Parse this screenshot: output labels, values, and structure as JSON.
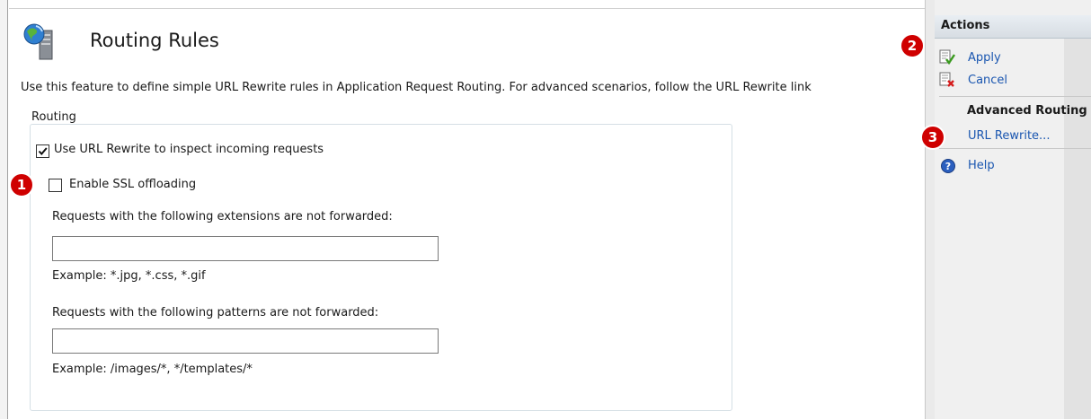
{
  "header": {
    "title": "Routing Rules",
    "description": "Use this feature to define simple URL Rewrite rules in Application Request Routing.  For advanced scenarios, follow the URL Rewrite link"
  },
  "routing": {
    "group_label": "Routing",
    "use_url_rewrite": {
      "label": "Use URL Rewrite to inspect incoming requests",
      "checked": true
    },
    "enable_ssl_offloading": {
      "label": "Enable SSL offloading",
      "checked": false
    },
    "extensions": {
      "label": "Requests with the following extensions are not forwarded:",
      "value": "",
      "example": "Example: *.jpg, *.css, *.gif"
    },
    "patterns": {
      "label": "Requests with the following patterns are not forwarded:",
      "value": "",
      "example": "Example: /images/*, */templates/*"
    }
  },
  "actions": {
    "title": "Actions",
    "apply": "Apply",
    "cancel": "Cancel",
    "advanced_section": "Advanced Routing",
    "url_rewrite": "URL Rewrite...",
    "help": "Help"
  },
  "callouts": [
    "1",
    "2",
    "3"
  ],
  "colors": {
    "link": "#1a56b0",
    "callout": "#d40000"
  }
}
